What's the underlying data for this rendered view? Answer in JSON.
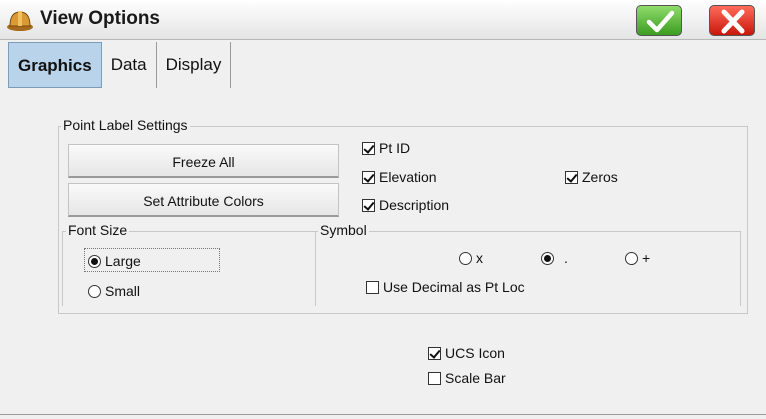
{
  "window": {
    "title": "View Options",
    "ok_icon": "checkmark-icon",
    "cancel_icon": "close-icon",
    "app_icon": "hardhat-icon"
  },
  "tabs": [
    {
      "label": "Graphics",
      "active": true
    },
    {
      "label": "Data",
      "active": false
    },
    {
      "label": "Display",
      "active": false
    }
  ],
  "point_label_settings": {
    "label": "Point Label Settings",
    "freeze_all": "Freeze All",
    "set_attribute_colors": "Set Attribute Colors",
    "pt_id": {
      "label": "Pt ID",
      "checked": true
    },
    "elevation": {
      "label": "Elevation",
      "checked": true
    },
    "zeros": {
      "label": "Zeros",
      "checked": true
    },
    "description": {
      "label": "Description",
      "checked": true
    }
  },
  "font_size": {
    "label": "Font Size",
    "large": {
      "label": "Large",
      "checked": true
    },
    "small": {
      "label": "Small",
      "checked": false
    }
  },
  "symbol": {
    "label": "Symbol",
    "x": {
      "label": "x",
      "checked": false
    },
    "dot": {
      "label": ".",
      "checked": true
    },
    "plus": {
      "label": "+",
      "checked": false
    },
    "use_decimal": {
      "label": "Use Decimal as Pt Loc",
      "checked": false
    }
  },
  "ucs_icon": {
    "label": "UCS Icon",
    "checked": true
  },
  "scale_bar": {
    "label": "Scale Bar",
    "checked": false
  }
}
